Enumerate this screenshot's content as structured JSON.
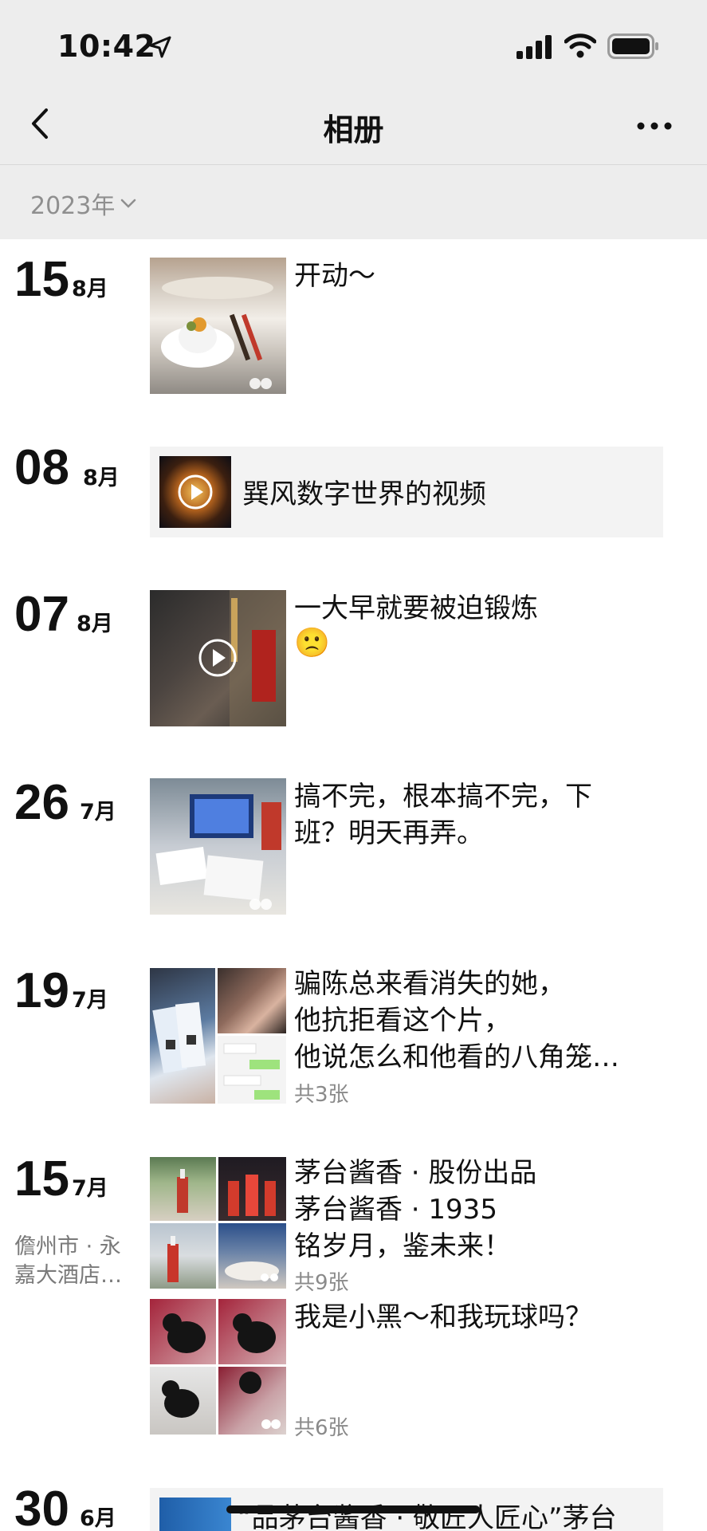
{
  "status": {
    "time": "10:42"
  },
  "nav": {
    "title": "相册"
  },
  "filter": {
    "year": "2023年"
  },
  "entries": [
    {
      "day": "15",
      "month": "8月",
      "caption": "开动～"
    },
    {
      "day": "08",
      "month": "8月",
      "caption": "巽风数字世界的视频"
    },
    {
      "day": "07",
      "month": "8月",
      "caption": "一大早就要被迫锻炼",
      "emoji": "🙁"
    },
    {
      "day": "26",
      "month": "7月",
      "caption_lines": [
        "搞不完，根本搞不完，下",
        "班？明天再弄。"
      ]
    },
    {
      "day": "19",
      "month": "7月",
      "caption_lines": [
        "骗陈总来看消失的她，",
        "他抗拒看这个片，",
        "他说怎么和他看的八角笼…"
      ],
      "count": "共3张"
    },
    {
      "day": "15",
      "month": "7月",
      "location": [
        "儋州市 · 永",
        "嘉大酒店…"
      ],
      "posts": [
        {
          "caption_lines": [
            "茅台酱香 · 股份出品",
            "茅台酱香 · 1935",
            "铭岁月，鉴未来！"
          ],
          "count": "共9张"
        },
        {
          "caption_lines": [
            "我是小黑～和我玩球吗？"
          ],
          "count": "共6张"
        }
      ]
    },
    {
      "day": "30",
      "month": "6月",
      "caption": "“品茅台酱香 · 敬匠人匠心”茅台"
    }
  ],
  "colors": {
    "topbar": "#ededed",
    "text": "#111111",
    "muted": "#8a8a8a",
    "card": "#f3f3f3"
  }
}
